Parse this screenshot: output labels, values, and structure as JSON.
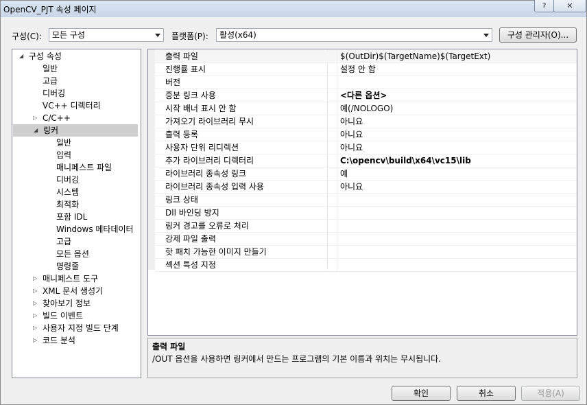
{
  "window": {
    "title": "OpenCV_PJT 속성 페이지",
    "help_label": "?",
    "close_label": "✕"
  },
  "toolbar": {
    "config_label": "구성(C):",
    "config_value": "모든 구성",
    "platform_label": "플랫폼(P):",
    "platform_value": "활성(x64)",
    "config_manager_label": "구성 관리자(O)..."
  },
  "tree": {
    "root": "구성 속성",
    "items": [
      {
        "label": "일반",
        "expander": ""
      },
      {
        "label": "고급",
        "expander": ""
      },
      {
        "label": "디버깅",
        "expander": ""
      },
      {
        "label": "VC++ 디렉터리",
        "expander": ""
      },
      {
        "label": "C/C++",
        "expander": "collapsed"
      },
      {
        "label": "링커",
        "expander": "expanded",
        "selected": true,
        "children": [
          "일반",
          "입력",
          "매니페스트 파일",
          "디버깅",
          "시스템",
          "최적화",
          "포함 IDL",
          "Windows 메타데이터",
          "고급",
          "모든 옵션",
          "명령줄"
        ]
      },
      {
        "label": "매니페스트 도구",
        "expander": "collapsed"
      },
      {
        "label": "XML 문서 생성기",
        "expander": "collapsed"
      },
      {
        "label": "찾아보기 정보",
        "expander": "collapsed"
      },
      {
        "label": "빌드 이벤트",
        "expander": "collapsed"
      },
      {
        "label": "사용자 지정 빌드 단계",
        "expander": "collapsed"
      },
      {
        "label": "코드 분석",
        "expander": "collapsed"
      }
    ]
  },
  "properties": [
    {
      "name": "출력 파일",
      "value": "$(OutDir)$(TargetName)$(TargetExt)",
      "bold": false
    },
    {
      "name": "진행률 표시",
      "value": "설정 안 함",
      "bold": false
    },
    {
      "name": "버전",
      "value": "",
      "bold": false
    },
    {
      "name": "증분 링크 사용",
      "value": "<다른 옵션>",
      "bold": true
    },
    {
      "name": "시작 배너 표시 안 함",
      "value": "예(/NOLOGO)",
      "bold": false
    },
    {
      "name": "가져오기 라이브러리 무시",
      "value": "아니요",
      "bold": false
    },
    {
      "name": "출력 등록",
      "value": "아니요",
      "bold": false
    },
    {
      "name": "사용자 단위 리디렉션",
      "value": "아니요",
      "bold": false
    },
    {
      "name": "추가 라이브러리 디렉터리",
      "value": "C:\\opencv\\build\\x64\\vc15\\lib",
      "bold": true
    },
    {
      "name": "라이브러리 종속성 링크",
      "value": "예",
      "bold": false
    },
    {
      "name": "라이브러리 종속성 입력 사용",
      "value": "아니요",
      "bold": false
    },
    {
      "name": "링크 상태",
      "value": "",
      "bold": false
    },
    {
      "name": "Dll 바인딩 방지",
      "value": "",
      "bold": false
    },
    {
      "name": "링커 경고를 오류로 처리",
      "value": "",
      "bold": false
    },
    {
      "name": "강제 파일 출력",
      "value": "",
      "bold": false
    },
    {
      "name": "핫 패치 가능한 이미지 만들기",
      "value": "",
      "bold": false
    },
    {
      "name": "섹션 특성 지정",
      "value": "",
      "bold": false
    }
  ],
  "description": {
    "title": "출력 파일",
    "text": "/OUT 옵션을 사용하면 링커에서 만드는 프로그램의 기본 이름과 위치는 무시됩니다."
  },
  "buttons": {
    "ok": "확인",
    "cancel": "취소",
    "apply": "적용(A)"
  }
}
